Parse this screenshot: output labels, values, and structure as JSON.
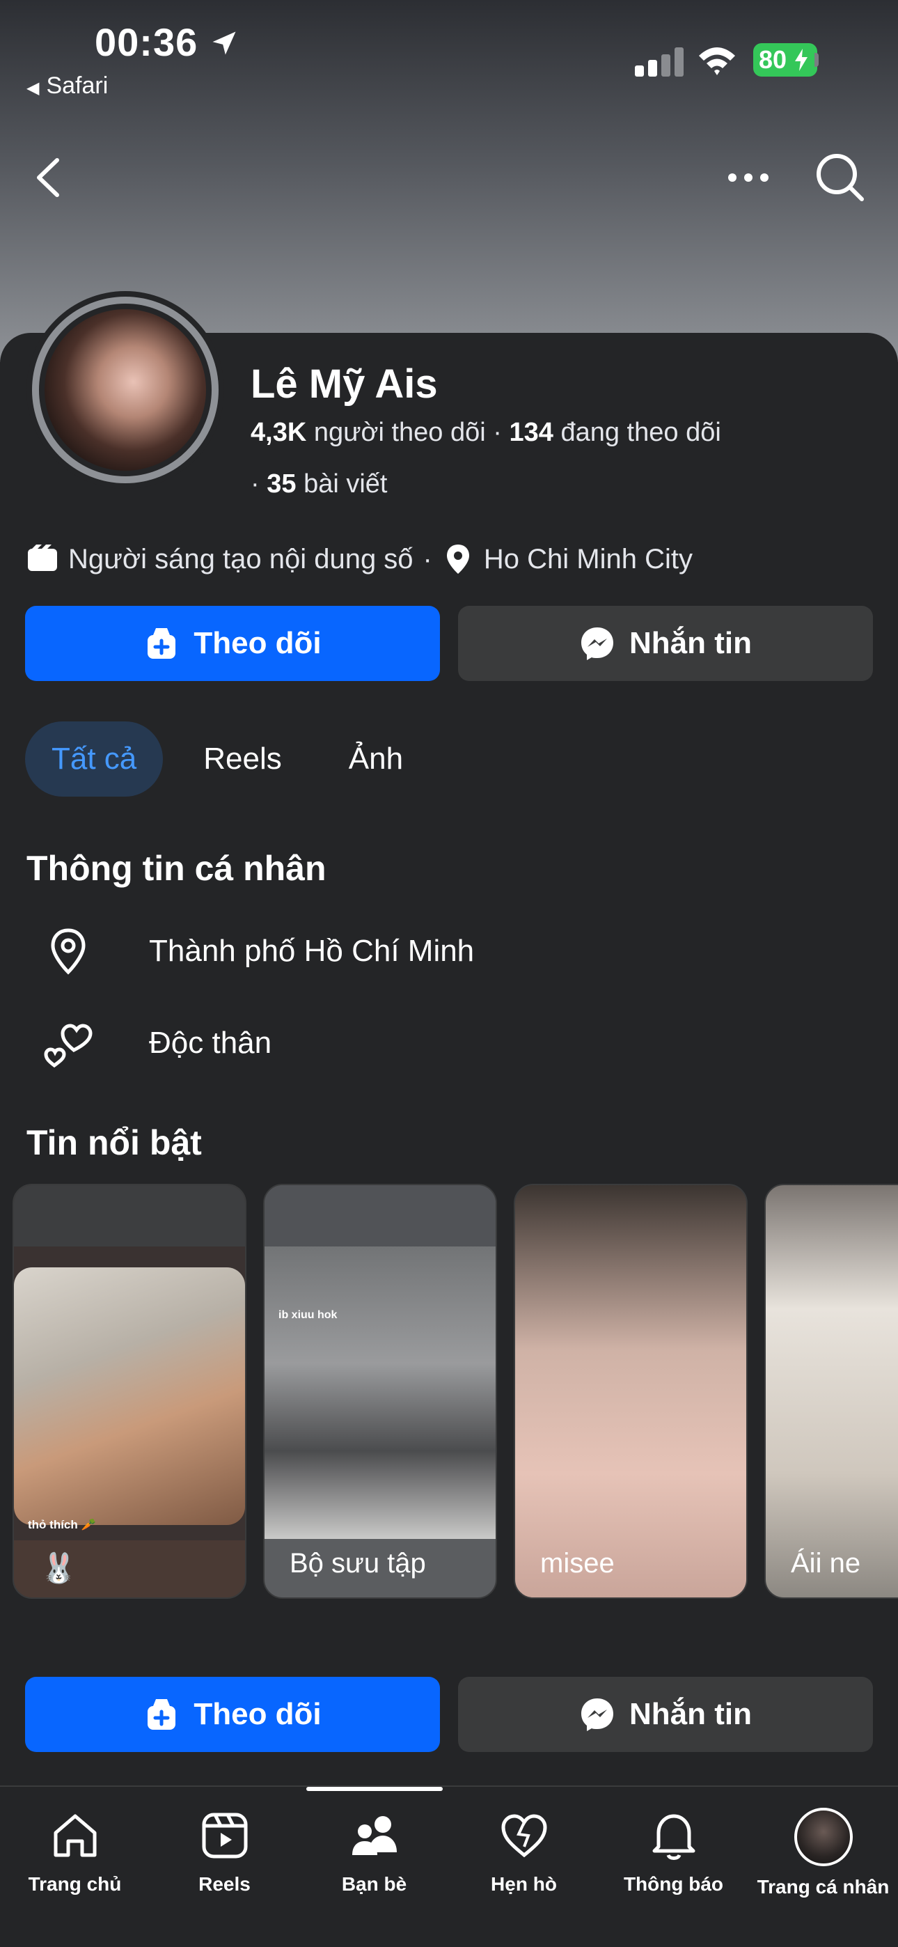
{
  "status_bar": {
    "time": "00:36",
    "back_app": "Safari",
    "battery": "80"
  },
  "profile": {
    "name": "Lê Mỹ Ais",
    "followers_count": "4,3K",
    "followers_label": "người theo dõi",
    "following_count": "134",
    "following_label": "đang theo dõi",
    "posts_count": "35",
    "posts_label": "bài viết",
    "category": "Người sáng tạo nội dung số",
    "location": "Ho Chi Minh City"
  },
  "actions": {
    "follow_label": "Theo dõi",
    "message_label": "Nhắn tin"
  },
  "tabs": [
    {
      "label": "Tất cả",
      "active": true
    },
    {
      "label": "Reels",
      "active": false
    },
    {
      "label": "Ảnh",
      "active": false
    }
  ],
  "personal_info": {
    "title": "Thông tin cá nhân",
    "city": "Thành phố Hồ Chí Minh",
    "relationship": "Độc thân"
  },
  "highlights": {
    "title": "Tin nổi bật",
    "items": [
      {
        "caption": "🐰",
        "overlay_text": "thỏ thích 🥕"
      },
      {
        "caption": "Bộ sưu tập",
        "overlay_text": "ib xiuu hok"
      },
      {
        "caption": "misee"
      },
      {
        "caption": "Áii ne"
      }
    ]
  },
  "bottom_nav": [
    {
      "label": "Trang chủ",
      "icon": "home-icon"
    },
    {
      "label": "Reels",
      "icon": "reels-icon"
    },
    {
      "label": "Bạn bè",
      "icon": "friends-icon",
      "active": true
    },
    {
      "label": "Hẹn hò",
      "icon": "dating-heart-icon"
    },
    {
      "label": "Thông báo",
      "icon": "bell-icon"
    },
    {
      "label": "Trang cá nhân",
      "icon": "profile-avatar"
    }
  ],
  "colors": {
    "background": "#242527",
    "primary_button": "#0866ff",
    "secondary_button": "#3a3b3c",
    "active_tab_bg": "#263951",
    "active_tab_text": "#4599ff",
    "battery": "#34c759"
  }
}
